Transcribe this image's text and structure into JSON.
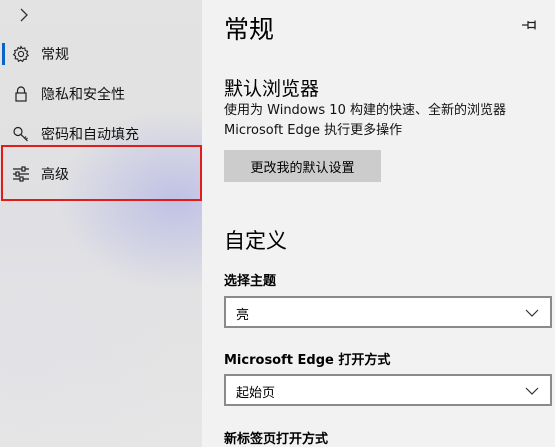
{
  "nav": {
    "items": [
      {
        "id": "general",
        "label": "常规",
        "icon": "gear-icon",
        "selected": true
      },
      {
        "id": "privacy",
        "label": "隐私和安全性",
        "icon": "lock-icon",
        "selected": false
      },
      {
        "id": "passwords",
        "label": "密码和自动填充",
        "icon": "key-icon",
        "selected": false
      },
      {
        "id": "advanced",
        "label": "高级",
        "icon": "sliders-icon",
        "selected": false,
        "highlighted": true
      }
    ]
  },
  "content": {
    "title": "常规",
    "default_browser": {
      "heading": "默认浏览器",
      "description_line1": "使用为 Windows 10 构建的快速、全新的浏览器",
      "description_line2": "Microsoft Edge 执行更多操作",
      "button_label": "更改我的默认设置"
    },
    "customize": {
      "heading": "自定义",
      "theme_label": "选择主题",
      "theme_value": "亮",
      "open_with_label": "Microsoft Edge 打开方式",
      "open_with_value": "起始页",
      "new_tab_label": "新标签页打开方式"
    }
  },
  "colors": {
    "accent": "#0a64c8",
    "highlight_border": "#e41b1b",
    "button_bg": "#cccccc"
  }
}
